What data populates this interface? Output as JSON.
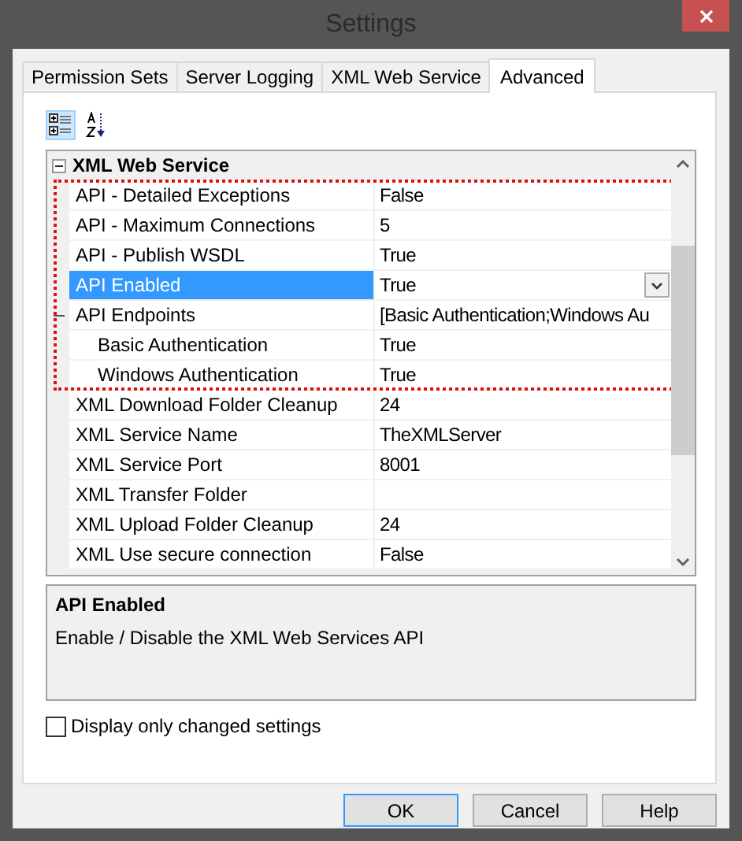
{
  "window": {
    "title": "Settings"
  },
  "tabs": [
    {
      "label": "Permission Sets",
      "selected": false
    },
    {
      "label": "Server Logging",
      "selected": false
    },
    {
      "label": "XML Web Service",
      "selected": false
    },
    {
      "label": "Advanced",
      "selected": true
    }
  ],
  "toolbar": [
    {
      "kind": "categorized",
      "selected": true
    },
    {
      "kind": "alphabetical",
      "selected": false
    }
  ],
  "grid": {
    "category": {
      "label": "XML Web Service",
      "expanded": true
    },
    "properties": [
      {
        "name": "API - Detailed Exceptions",
        "value": "False",
        "selected": false,
        "annotated": true
      },
      {
        "name": "API - Maximum Connections",
        "value": "5",
        "selected": false,
        "annotated": true
      },
      {
        "name": "API - Publish WSDL",
        "value": "True",
        "selected": false,
        "annotated": true
      },
      {
        "name": "API Enabled",
        "value": "True",
        "selected": true,
        "annotated": true
      },
      {
        "name": "API Endpoints",
        "value": "[Basic Authentication;Windows Au",
        "selected": false,
        "annotated": true,
        "expanded": true,
        "children": [
          {
            "name": "Basic Authentication",
            "value": "True",
            "selected": false,
            "annotated": true
          },
          {
            "name": "Windows Authentication",
            "value": "True",
            "selected": false,
            "annotated": true
          }
        ]
      },
      {
        "name": "XML Download Folder Cleanup",
        "value": "24",
        "selected": false,
        "annotated": false
      },
      {
        "name": "XML Service Name",
        "value": "TheXMLServer",
        "selected": false,
        "annotated": false
      },
      {
        "name": "XML Service Port",
        "value": "8001",
        "selected": false,
        "annotated": false
      },
      {
        "name": "XML Transfer Folder",
        "selected": false,
        "annotated": false
      },
      {
        "name": "XML Upload Folder Cleanup",
        "value": "24",
        "selected": false,
        "annotated": false
      },
      {
        "name": "XML Use secure connection",
        "value": "False",
        "selected": false,
        "annotated": false
      }
    ]
  },
  "description": {
    "title": "API Enabled",
    "text": "Enable / Disable the XML Web Services API"
  },
  "checkbox": {
    "label": "Display only changed settings",
    "checked": false
  },
  "buttons": [
    {
      "label": "OK",
      "default": true
    },
    {
      "label": "Cancel",
      "default": false
    },
    {
      "label": "Help",
      "default": false
    }
  ]
}
